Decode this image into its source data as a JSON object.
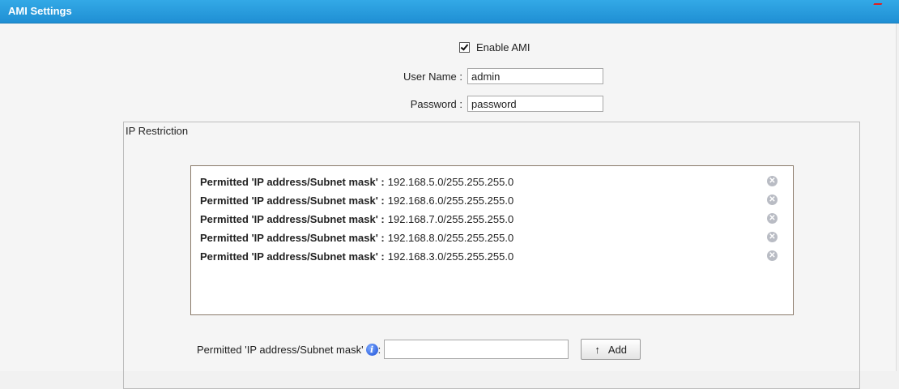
{
  "header": {
    "title": "AMI Settings"
  },
  "enable_ami": {
    "label": "Enable AMI",
    "checked": true
  },
  "username": {
    "label": "User Name :",
    "value": "admin"
  },
  "password": {
    "label": "Password :",
    "value": "password"
  },
  "ip_restriction": {
    "legend": "IP Restriction",
    "items": [
      {
        "key": "Permitted 'IP address/Subnet mask' :",
        "value": "192.168.5.0/255.255.255.0"
      },
      {
        "key": "Permitted 'IP address/Subnet mask' :",
        "value": "192.168.6.0/255.255.255.0"
      },
      {
        "key": "Permitted 'IP address/Subnet mask' :",
        "value": "192.168.7.0/255.255.255.0"
      },
      {
        "key": "Permitted 'IP address/Subnet mask' :",
        "value": "192.168.8.0/255.255.255.0"
      },
      {
        "key": "Permitted 'IP address/Subnet mask' :",
        "value": "192.168.3.0/255.255.255.0"
      }
    ],
    "add_label": "Permitted 'IP address/Subnet mask'",
    "add_colon": ":",
    "add_value": "",
    "add_button": "Add",
    "add_arrow": "↑",
    "info_glyph": "i",
    "delete_glyph": "✕"
  },
  "colors": {
    "header": "#1f8fd4",
    "delete_icon": "#b9bcc4",
    "info_icon": "#1d4fd6"
  }
}
